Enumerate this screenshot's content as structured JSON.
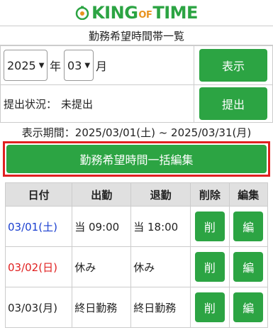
{
  "header": {
    "logo_king": "KING",
    "logo_of": "OF",
    "logo_time": "TIME",
    "subtitle": "勤務希望時間帯一覧"
  },
  "controls": {
    "year": "2025",
    "year_unit": "年",
    "month": "03",
    "month_unit": "月",
    "show_button": "表示",
    "status_label": "提出状況：",
    "status_value": "未提出",
    "submit_button": "提出"
  },
  "period_text": "表示期間：2025/03/01(土) ~ 2025/03/31(月)",
  "bulk_edit_button": "勤務希望時間一括編集",
  "table": {
    "headers": [
      "日付",
      "出勤",
      "退勤",
      "削除",
      "編集"
    ],
    "rows": [
      {
        "date": "03/01(土)",
        "day_type": "sat",
        "in": "当 09:00",
        "out": "当 18:00",
        "delete": "削",
        "edit": "編"
      },
      {
        "date": "03/02(日)",
        "day_type": "sun",
        "in": "休み",
        "out": "休み",
        "delete": "削",
        "edit": "編"
      },
      {
        "date": "03/03(月)",
        "day_type": "weekday",
        "in": "終日勤務",
        "out": "終日勤務",
        "delete": "削",
        "edit": "編"
      }
    ]
  },
  "colors": {
    "accent": "#2ca443",
    "highlight": "#e02020",
    "saturday": "#1a3fd0",
    "sunday": "#e02020",
    "header_bg": "#e0e0e0"
  },
  "icons": {
    "logo": "clock-icon",
    "select": "chevron-down-icon"
  }
}
